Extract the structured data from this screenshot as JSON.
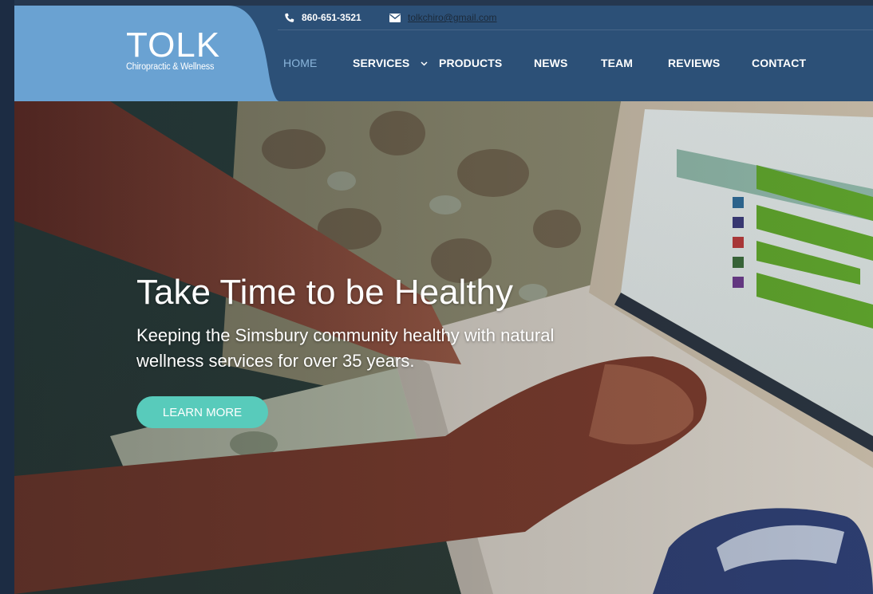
{
  "brand": {
    "name": "TOLK",
    "tagline": "Chiropractic & Wellness"
  },
  "topbar": {
    "phone": "860-651-3521",
    "email": "tolkchiro@gmail.com"
  },
  "nav": {
    "items": [
      {
        "label": "HOME",
        "active": true
      },
      {
        "label": "SERVICES",
        "has_dropdown": true
      },
      {
        "label": "PRODUCTS"
      },
      {
        "label": "NEWS"
      },
      {
        "label": "TEAM"
      },
      {
        "label": "REVIEWS"
      },
      {
        "label": "CONTACT"
      }
    ]
  },
  "hero": {
    "title": "Take Time to be Healthy",
    "subtitle": "Keeping the Simsbury community healthy with natural wellness services for over 35 years.",
    "button_label": "LEARN MORE"
  },
  "icons": [
    "phone-icon",
    "envelope-icon",
    "chevron-down-icon"
  ],
  "colors": {
    "header_bg": "#2c5077",
    "logo_panel": "#6aa2d2",
    "active_nav": "#8bb6dc",
    "button": "#58cbbb"
  }
}
